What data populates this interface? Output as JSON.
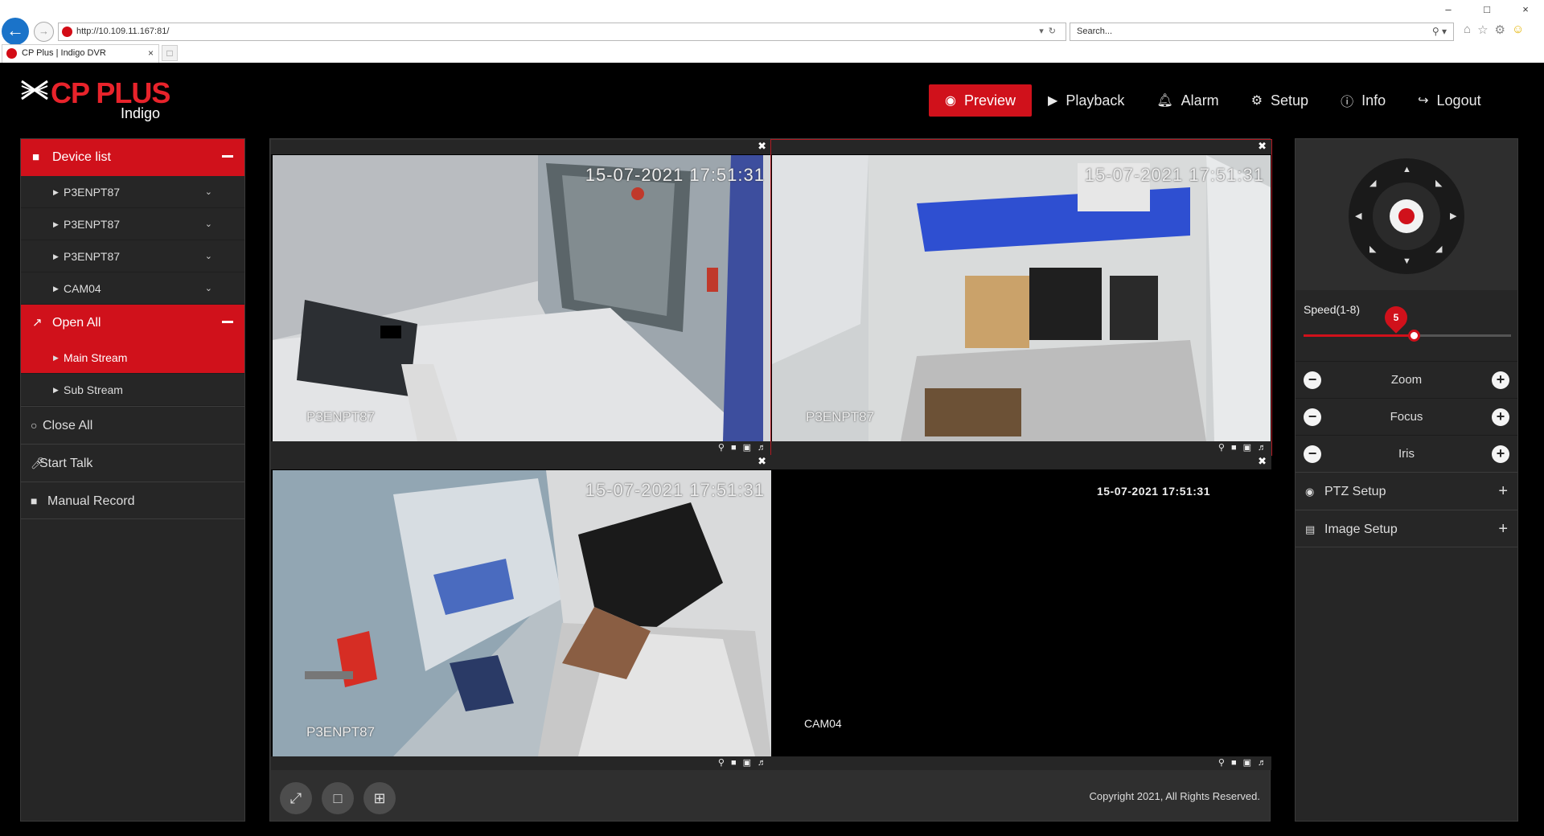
{
  "browser": {
    "url": "http://10.109.11.167:81/",
    "search_placeholder": "Search...",
    "tab_title": "CP Plus | Indigo DVR",
    "tab_close": "×",
    "window_controls": [
      "–",
      "□",
      "×"
    ]
  },
  "brand": {
    "name": "CP PLUS",
    "sub": "Indigo"
  },
  "nav": [
    {
      "icon": "eye-icon",
      "glyph": "◉",
      "label": "Preview",
      "active": true
    },
    {
      "icon": "play-icon",
      "glyph": "▶",
      "label": "Playback",
      "active": false
    },
    {
      "icon": "bell-icon",
      "glyph": "♪",
      "label": "Alarm",
      "active": false
    },
    {
      "icon": "gear-icon",
      "glyph": "⚙",
      "label": "Setup",
      "active": false
    },
    {
      "icon": "info-icon",
      "glyph": "ⓘ",
      "label": "Info",
      "active": false
    },
    {
      "icon": "logout-icon",
      "glyph": "↪",
      "label": "Logout",
      "active": false
    }
  ],
  "sidebar": {
    "device_list_label": "Device list",
    "devices": [
      "P3ENPT87",
      "P3ENPT87",
      "P3ENPT87",
      "CAM04"
    ],
    "open_all_label": "Open All",
    "streams": [
      {
        "label": "Main Stream",
        "active": true
      },
      {
        "label": "Sub Stream",
        "active": false
      }
    ],
    "close_all_label": "Close All",
    "start_talk_label": "Start Talk",
    "manual_record_label": "Manual Record"
  },
  "video": {
    "tiles": [
      {
        "name": "P3ENPT87",
        "timestamp": "15-07-2021 17:51:31",
        "has_video": true
      },
      {
        "name": "P3ENPT87",
        "timestamp": "15-07-2021 17:51:31",
        "has_video": true,
        "selected": true
      },
      {
        "name": "P3ENPT87",
        "timestamp": "15-07-2021 17:51:31",
        "has_video": true
      },
      {
        "name": "CAM04",
        "timestamp": "15-07-2021 17:51:31",
        "has_video": false
      }
    ],
    "copyright": "Copyright 2021, All Rights Reserved."
  },
  "ptz": {
    "speed_label": "Speed(1-8)",
    "speed_value": "5",
    "speed_min": 1,
    "speed_max": 8,
    "controls": [
      "Zoom",
      "Focus",
      "Iris"
    ],
    "sections": [
      "PTZ Setup",
      "Image Setup"
    ]
  },
  "colors": {
    "accent": "#d0111b",
    "panel": "#262626",
    "background": "#000000"
  }
}
